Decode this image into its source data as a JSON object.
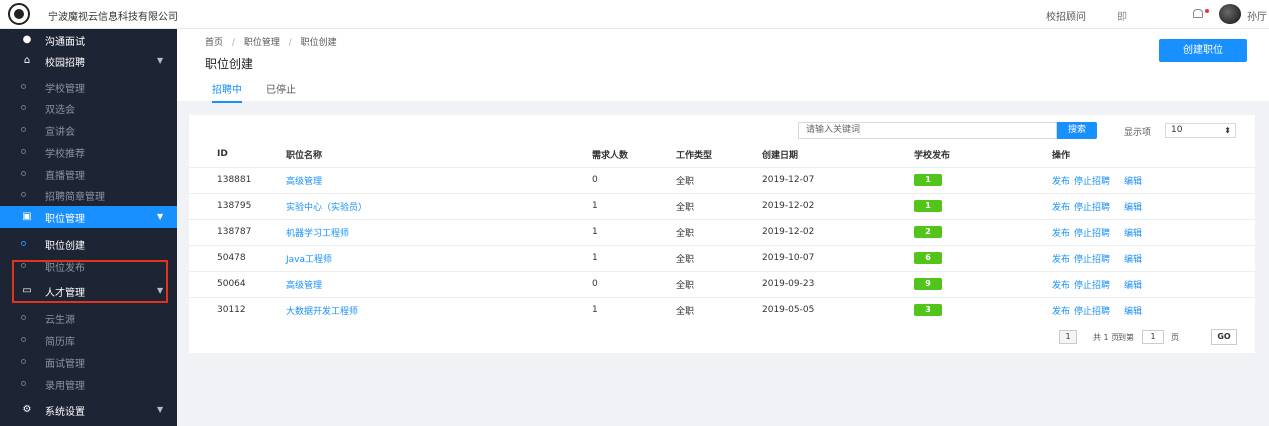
{
  "topbar": {
    "company": "宁波魔视云信息科技有限公司",
    "advisor": "校招顾问",
    "grid_label": "即",
    "username": "孙厅"
  },
  "sidebar": {
    "items": [
      {
        "label": "沟通面试",
        "kind": "main",
        "icon": "chat-icon"
      },
      {
        "label": "校园招聘",
        "kind": "main",
        "icon": "building-icon",
        "caret": true
      },
      {
        "label": "学校管理",
        "kind": "sub"
      },
      {
        "label": "双选会",
        "kind": "sub"
      },
      {
        "label": "宣讲会",
        "kind": "sub"
      },
      {
        "label": "学校推荐",
        "kind": "sub"
      },
      {
        "label": "直播管理",
        "kind": "sub"
      },
      {
        "label": "招聘简章管理",
        "kind": "sub"
      },
      {
        "label": "职位管理",
        "kind": "main",
        "icon": "briefcase-icon",
        "caret": true,
        "active": true
      },
      {
        "label": "职位创建",
        "kind": "sub",
        "current": true
      },
      {
        "label": "职位发布",
        "kind": "sub"
      },
      {
        "label": "人才管理",
        "kind": "main",
        "icon": "id-card-icon",
        "caret": true
      },
      {
        "label": "云生源",
        "kind": "sub"
      },
      {
        "label": "简历库",
        "kind": "sub"
      },
      {
        "label": "面试管理",
        "kind": "sub"
      },
      {
        "label": "录用管理",
        "kind": "sub"
      },
      {
        "label": "系统设置",
        "kind": "main",
        "icon": "gear-icon",
        "caret": true
      }
    ]
  },
  "header": {
    "breadcrumb": [
      "首页",
      "职位管理",
      "职位创建"
    ],
    "breadcrumb_sep": "/",
    "title": "职位创建",
    "create_button": "创建职位",
    "tabs": [
      "招聘中",
      "已停止"
    ]
  },
  "toolbar": {
    "search_placeholder": "请输入关键词",
    "search_button": "搜索",
    "show_label": "显示项",
    "show_value": "10"
  },
  "table": {
    "columns": [
      "ID",
      "职位名称",
      "需求人数",
      "工作类型",
      "创建日期",
      "学校发布",
      "操作"
    ],
    "rows": [
      {
        "id": "138881",
        "name": "高级管理",
        "need": "0",
        "type": "全职",
        "date": "2019-12-07",
        "pub": "1"
      },
      {
        "id": "138795",
        "name": "实验中心（实验员）",
        "need": "1",
        "type": "全职",
        "date": "2019-12-02",
        "pub": "1"
      },
      {
        "id": "138787",
        "name": "机器学习工程师",
        "need": "1",
        "type": "全职",
        "date": "2019-12-02",
        "pub": "2"
      },
      {
        "id": "50478",
        "name": "Java工程师",
        "need": "1",
        "type": "全职",
        "date": "2019-10-07",
        "pub": "6"
      },
      {
        "id": "50064",
        "name": "高级管理",
        "need": "0",
        "type": "全职",
        "date": "2019-09-23",
        "pub": "9"
      },
      {
        "id": "30112",
        "name": "大数据开发工程师",
        "need": "1",
        "type": "全职",
        "date": "2019-05-05",
        "pub": "3"
      }
    ],
    "actions": {
      "publish": "发布",
      "stop": "停止招聘",
      "edit": "编辑"
    }
  },
  "pager": {
    "current": "1",
    "total_text": "共 1 页",
    "goto_label": "到第",
    "goto_value": "1",
    "page_suffix": "页",
    "go": "GO"
  },
  "colors": {
    "accent": "#1890ff",
    "sidebar": "#1d2433",
    "badge": "#52c41a",
    "highlight": "#e2341d"
  }
}
